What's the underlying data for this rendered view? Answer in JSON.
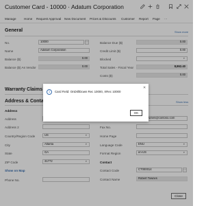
{
  "window": {
    "title": "Customer Card - 10000 · Adatum Corporation",
    "icons": [
      "edit-icon",
      "add-icon",
      "delete-icon",
      "bookmark-icon",
      "collapse-icon",
      "expand-icon",
      "close-icon"
    ]
  },
  "actionbar": {
    "items": [
      "Manage",
      "Home",
      "Request Approval",
      "New Document",
      "Prices & Discounts",
      "Customer",
      "Report",
      "Page",
      "···"
    ]
  },
  "general": {
    "title": "General",
    "show_more": "Show more",
    "left_fields": [
      {
        "label": "No.",
        "value": "10000"
      },
      {
        "label": "Name",
        "value": "Adatum Corporation"
      },
      {
        "label": "Balance ($)",
        "value": "0.00"
      },
      {
        "label": "Balance ($) As Vendor",
        "value": "0.00"
      }
    ],
    "right_fields": [
      {
        "label": "Balance Due ($)",
        "value": "0.00"
      },
      {
        "label": "Credit Limit ($)",
        "value": "0.00"
      },
      {
        "label": "Blocked",
        "value": ""
      },
      {
        "label": "Total Sales - Fiscal Year",
        "value": "8,862.40"
      },
      {
        "label": "Costs ($)",
        "value": "0.00"
      }
    ]
  },
  "warranty": {
    "title": "Warranty Claims",
    "chevron": "›"
  },
  "address": {
    "title": "Address & Contact",
    "show_more": "Show less",
    "address_header": "Address",
    "contact_header": "Contact",
    "left_fields": [
      {
        "label": "Address",
        "value": ""
      },
      {
        "label": "Address 2",
        "value": ""
      },
      {
        "label": "Country/Region Code",
        "value": "US"
      },
      {
        "label": "City",
        "value": "Atlanta"
      },
      {
        "label": "State",
        "value": "GA"
      },
      {
        "label": "ZIP Code",
        "value": "31772"
      }
    ],
    "show_on_map": "Show on Map",
    "phone_label": "Phone No.",
    "right_fields": [
      {
        "label": "",
        "value": ""
      },
      {
        "label": "Email",
        "value": "robert.townes@contoso.com"
      },
      {
        "label": "Fax No.",
        "value": ""
      },
      {
        "label": "Home Page",
        "value": ""
      },
      {
        "label": "Language Code",
        "value": "ENU"
      },
      {
        "label": "Format Region",
        "value": "en-US"
      }
    ],
    "contact_fields": [
      {
        "label": "Contact Code",
        "value": "CT000014"
      },
      {
        "label": "Contact Name",
        "value": "Robert Townes"
      }
    ]
  },
  "dialog": {
    "message": "Card Field: OnDrillDown Rec 10000, XRec 10000",
    "ok_label": "OK",
    "close_glyph": "✕",
    "info_glyph": "i"
  },
  "footer": {
    "close_label": "Close"
  }
}
